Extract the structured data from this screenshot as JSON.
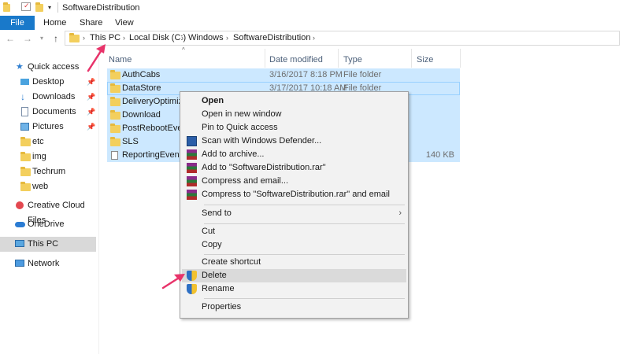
{
  "window": {
    "title": "SoftwareDistribution"
  },
  "ribbon": {
    "tabs": [
      "File",
      "Home",
      "Share",
      "View"
    ]
  },
  "address": {
    "crumbs": [
      "This PC",
      "Local Disk (C:)",
      "Windows",
      "SoftwareDistribution"
    ]
  },
  "sidebar": {
    "items": [
      {
        "label": "Quick access",
        "icon": "star-icon"
      },
      {
        "label": "Desktop",
        "icon": "desktop-icon",
        "pinned": true
      },
      {
        "label": "Downloads",
        "icon": "download-icon",
        "pinned": true
      },
      {
        "label": "Documents",
        "icon": "documents-icon",
        "pinned": true
      },
      {
        "label": "Pictures",
        "icon": "pictures-icon",
        "pinned": true
      },
      {
        "label": "etc",
        "icon": "folder-icon"
      },
      {
        "label": "img",
        "icon": "folder-icon"
      },
      {
        "label": "Techrum",
        "icon": "folder-icon"
      },
      {
        "label": "web",
        "icon": "folder-icon"
      },
      {
        "label": "Creative Cloud Files",
        "icon": "creative-cloud-icon"
      },
      {
        "label": "OneDrive",
        "icon": "onedrive-icon"
      },
      {
        "label": "This PC",
        "icon": "computer-icon",
        "selected": true
      },
      {
        "label": "Network",
        "icon": "network-icon"
      }
    ]
  },
  "columns": {
    "name": "Name",
    "date": "Date modified",
    "type": "Type",
    "size": "Size"
  },
  "files": [
    {
      "name": "AuthCabs",
      "date": "3/16/2017 8:18 PM",
      "type": "File folder",
      "size": ""
    },
    {
      "name": "DataStore",
      "date": "3/17/2017 10:18 AM",
      "type": "File folder",
      "size": ""
    },
    {
      "name": "DeliveryOptimizat",
      "date": "",
      "type": "",
      "size": ""
    },
    {
      "name": "Download",
      "date": "",
      "type": "",
      "size": ""
    },
    {
      "name": "PostRebootEventC",
      "date": "",
      "type": "",
      "size": ""
    },
    {
      "name": "SLS",
      "date": "",
      "type": "",
      "size": ""
    },
    {
      "name": "ReportingEvents",
      "date": "",
      "type": "",
      "size": "140 KB"
    }
  ],
  "context_menu": {
    "open": "Open",
    "open_new_window": "Open in new window",
    "pin_quick": "Pin to Quick access",
    "scan": "Scan with Windows Defender...",
    "add_archive": "Add to archive...",
    "add_rar": "Add to \"SoftwareDistribution.rar\"",
    "compress_email": "Compress and email...",
    "compress_rar_email": "Compress to \"SoftwareDistribution.rar\" and email",
    "send_to": "Send to",
    "cut": "Cut",
    "copy": "Copy",
    "create_shortcut": "Create shortcut",
    "delete": "Delete",
    "rename": "Rename",
    "properties": "Properties"
  },
  "colors": {
    "accent": "#1979ca",
    "selection": "#cce8ff",
    "annotation": "#e8336a"
  }
}
